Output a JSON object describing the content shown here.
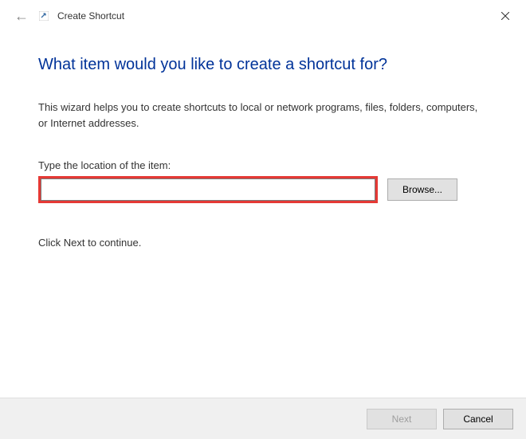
{
  "window": {
    "title": "Create Shortcut"
  },
  "content": {
    "heading": "What item would you like to create a shortcut for?",
    "description": "This wizard helps you to create shortcuts to local or network programs, files, folders, computers, or Internet addresses.",
    "input_label": "Type the location of the item:",
    "input_value": "",
    "browse_label": "Browse...",
    "continue_text": "Click Next to continue."
  },
  "footer": {
    "next_label": "Next",
    "cancel_label": "Cancel"
  }
}
